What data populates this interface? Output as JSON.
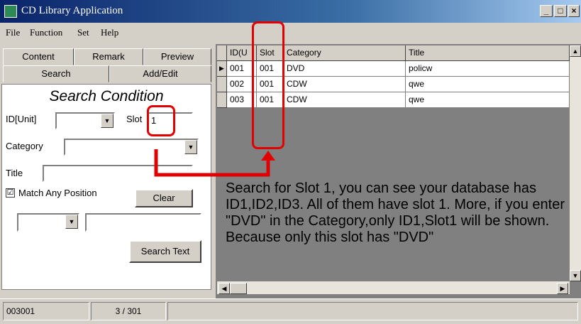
{
  "window": {
    "title": "CD Library Application",
    "min": "_",
    "max": "□",
    "close": "×"
  },
  "menu": [
    "File",
    "Function",
    "Set",
    "Help"
  ],
  "tabs_row1": [
    "Content",
    "Remark",
    "Preview"
  ],
  "tabs_row2": [
    "Search",
    "Add/Edit"
  ],
  "search": {
    "title": "Search Condition",
    "id_label": "ID[Unit]",
    "slot_label": "Slot",
    "slot_value": "1",
    "category_label": "Category",
    "title_label": "Title",
    "match_label": "Match Any Position",
    "match_checked": "☑",
    "clear_button": "Clear",
    "search_text_button": "Search Text"
  },
  "grid": {
    "columns": [
      "ID(U",
      "Slot",
      "Category",
      "Title"
    ],
    "rows": [
      {
        "id": "001",
        "slot": "001",
        "category": "DVD",
        "title": "policw",
        "current": true
      },
      {
        "id": "002",
        "slot": "001",
        "category": "CDW",
        "title": "qwe",
        "current": false
      },
      {
        "id": "003",
        "slot": "001",
        "category": "CDW",
        "title": "qwe",
        "current": false
      }
    ]
  },
  "caption": "Search for Slot 1, you can see your database has ID1,ID2,ID3. All of them have slot 1.  More, if you enter \"DVD\" in the Category,only ID1,Slot1 will be shown. Because only this slot has \"DVD\"",
  "status": {
    "left": "003001",
    "right": "3 / 301"
  },
  "colors": {
    "annotation": "#e00000",
    "titlebar": "#0a246a"
  }
}
